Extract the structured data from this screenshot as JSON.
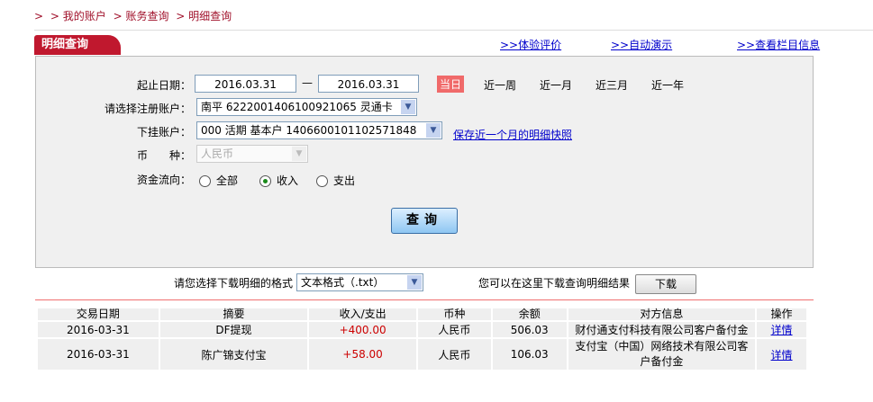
{
  "breadcrumb": {
    "prefix": ">",
    "items": [
      "> 我的账户",
      "> 账务查询",
      "> 明细查询"
    ]
  },
  "tab_title": "明细查询",
  "top_links": [
    ">>体验评价",
    ">>自动演示",
    ">>查看栏目信息"
  ],
  "form": {
    "date_label": "起止日期：",
    "start_date": "2016.03.31",
    "date_sep": "—",
    "end_date": "2016.03.31",
    "quick_ranges": [
      "当日",
      "近一周",
      "近一月",
      "近三月",
      "近一年"
    ],
    "quick_selected": "当日",
    "account_label": "请选择注册账户：",
    "account_value": "南平  6222001406100921065 灵通卡",
    "sub_account_label": "下挂账户：",
    "sub_account_value": "000 活期 基本户 1406600101102571848",
    "save_link": "保存近一个月的明细快照",
    "currency_label": "币　　种：",
    "currency_value": "人民币",
    "flow_label": "资金流向：",
    "flow_options": [
      "全部",
      "收入",
      "支出"
    ],
    "flow_selected": "收入",
    "query_button": "查询"
  },
  "download": {
    "format_label": "请您选择下载明细的格式",
    "format_value": "文本格式（.txt）",
    "hint": "您可以在这里下载查询明细结果",
    "button": "下载"
  },
  "table": {
    "headers": [
      "交易日期",
      "摘要",
      "收入/支出",
      "币种",
      "余额",
      "对方信息",
      "操作"
    ],
    "rows": [
      [
        "2016-03-31",
        "DF提现",
        "+400.00",
        "人民币",
        "506.03",
        "财付通支付科技有限公司客户备付金",
        "详情"
      ],
      [
        "2016-03-31",
        "陈广锦支付宝",
        "+58.00",
        "人民币",
        "106.03",
        "支付宝（中国）网络技术有限公司客户备付金",
        "详情"
      ]
    ]
  },
  "colors": {
    "brand": "#c0182e",
    "link": "#0000cc",
    "amount": "#cc0000"
  }
}
